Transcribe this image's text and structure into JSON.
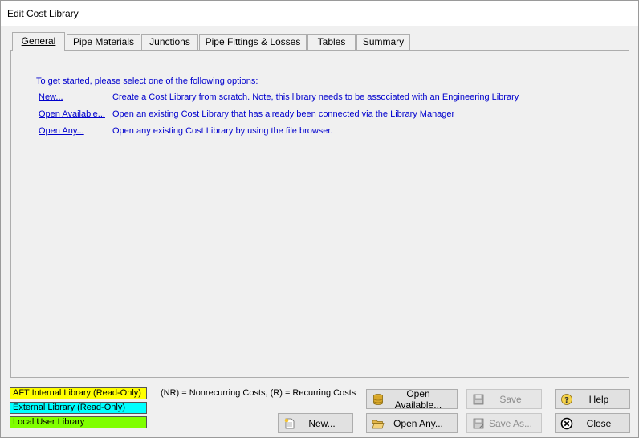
{
  "window": {
    "title": "Edit Cost Library"
  },
  "tabs": [
    {
      "label": "General"
    },
    {
      "label": "Pipe Materials"
    },
    {
      "label": "Junctions"
    },
    {
      "label": "Pipe Fittings & Losses"
    },
    {
      "label": "Tables"
    },
    {
      "label": "Summary"
    }
  ],
  "general": {
    "intro": "To get started, please select one of the following options:",
    "options": [
      {
        "link": "New...",
        "description": "Create a Cost Library from scratch. Note, this library needs to be associated with an Engineering Library"
      },
      {
        "link": "Open Available...",
        "description": "Open an existing Cost Library that has already been connected via the Library Manager"
      },
      {
        "link": "Open Any...",
        "description": "Open any existing Cost Library by using the file browser."
      }
    ]
  },
  "legend": [
    {
      "label": "AFT Internal Library (Read-Only)",
      "color": "#ffff00"
    },
    {
      "label": "External Library (Read-Only)",
      "color": "#00ffff"
    },
    {
      "label": "Local User Library",
      "color": "#80ff00"
    }
  ],
  "note": "(NR) = Nonrecurring Costs, (R) = Recurring Costs",
  "buttons": {
    "open_available": "Open Available...",
    "open_any": "Open Any...",
    "new": "New...",
    "save": "Save",
    "save_as": "Save As...",
    "help": "Help",
    "close": "Close"
  }
}
